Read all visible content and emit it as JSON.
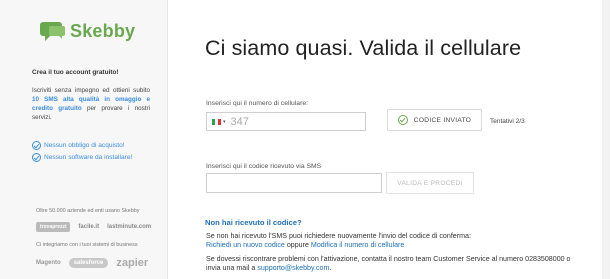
{
  "brand": {
    "name": "Skebby",
    "color": "#6aa84f"
  },
  "sidebar": {
    "title": "Crea il tuo account gratuito!",
    "desc_prefix": "Iscriviti senza impegno ed ottieni subito ",
    "desc_highlight": "10 SMS alta qualità in omaggio e credito gratuito",
    "desc_suffix": " per provare i nostri servizi.",
    "checks": [
      "Nessun obbligo di acquisto!",
      "Nessun software da installare!"
    ],
    "trusted_by": "Oltre 50.000 aziende ed enti usano Skebby",
    "integrations_label": "Ci integriamo con i tuoi sistemi di business",
    "brands_row1": [
      "trovaprezzi",
      "facile.it",
      "lastminute.com"
    ],
    "brands_row2": [
      "Magento",
      "salesforce",
      "zapier"
    ]
  },
  "main": {
    "title": "Ci siamo quasi. Valida il cellulare",
    "phone_label": "Inserisci qui il numero di cellulare:",
    "phone_value": "347",
    "sent_button": "CODICE INVIATO",
    "attempts": "Tentativi 2/3",
    "code_label": "Inserisci qui il codice ricevuto via SMS",
    "code_value": "",
    "verify_button": "VALIDA E PROCEDI",
    "no_code_title": "Non hai ricevuto il codice?",
    "resend_text": "Se non hai ricevuto l'SMS puoi richiedere nuovamente l'invio del codice di conferma:",
    "new_code_link": "Richiedi un nuovo codice",
    "or_text": " oppure ",
    "modify_link": "Modifica il numero di cellulare",
    "support_text": "Se dovessi riscontrare problemi con l'attivazione, contatta il nostro team Customer Service al numero 0283508000 o invia una mail a ",
    "support_email": "supporto@skebby.com",
    "support_end": "."
  },
  "colors": {
    "link": "#1e6fb8",
    "accent_blue": "#3a8dde",
    "success_green": "#6aa84f"
  }
}
